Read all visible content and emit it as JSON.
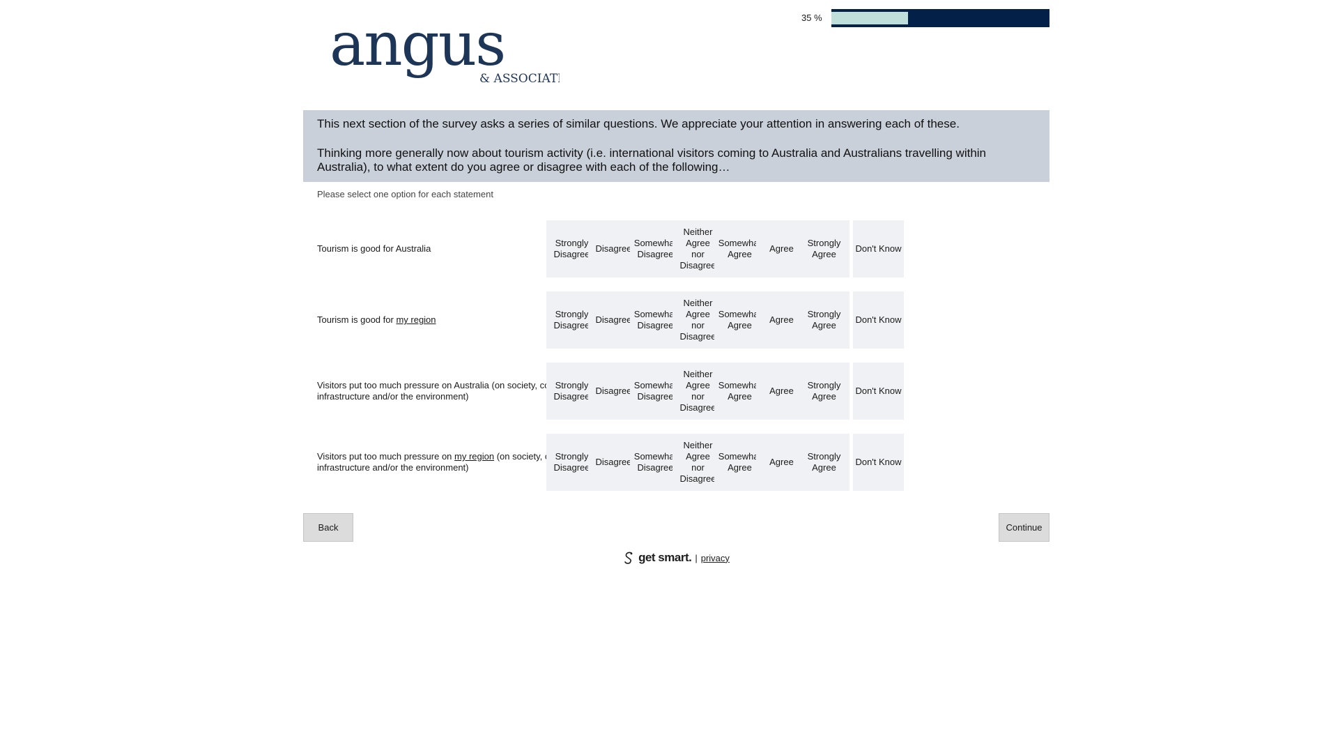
{
  "logo": {
    "wordmark": "angus",
    "subline": "& ASSOCIATES"
  },
  "progress": {
    "label": "35 %",
    "value_percent": 35
  },
  "intro": {
    "paragraph_1": "This next section of the survey asks a series of similar questions. We appreciate your attention in answering each of these.",
    "paragraph_2": "Thinking more generally now about tourism activity (i.e. international visitors coming to Australia and Australians travelling within Australia), to what extent do you agree or disagree with each of the following…"
  },
  "instruction": "Please select one option for each statement",
  "scale": {
    "options": [
      [
        "Strongly",
        "Disagree"
      ],
      [
        "Disagree"
      ],
      [
        "Somewhat",
        "Disagree"
      ],
      [
        "Neither",
        "Agree",
        "nor",
        "Disagree"
      ],
      [
        "Somewhat",
        "Agree"
      ],
      [
        "Agree"
      ],
      [
        "Strongly",
        "Agree"
      ]
    ],
    "dont_know": "Don't Know"
  },
  "statements": [
    {
      "before": "Tourism is good for Australia",
      "link": "",
      "after": ""
    },
    {
      "before": "Tourism is good for ",
      "link": "my region",
      "after": ""
    },
    {
      "before": "Visitors put too much pressure on Australia (on society, communities, infrastructure and/or the environment)",
      "link": "",
      "after": ""
    },
    {
      "before": "Visitors put too much pressure on ",
      "link": "my region",
      "after": " (on society, communities, infrastructure and/or the environment)"
    }
  ],
  "buttons": {
    "back": "Back",
    "continue": "Continue"
  },
  "footer": {
    "brand": "get smart.",
    "separator": "|",
    "privacy": "privacy"
  },
  "colors": {
    "navy": "#032148",
    "progress_fill": "#bfe0da",
    "intro_bg": "#c9d0da",
    "option_bg": "#f0f1f4",
    "logo_text": "#1d3557"
  }
}
